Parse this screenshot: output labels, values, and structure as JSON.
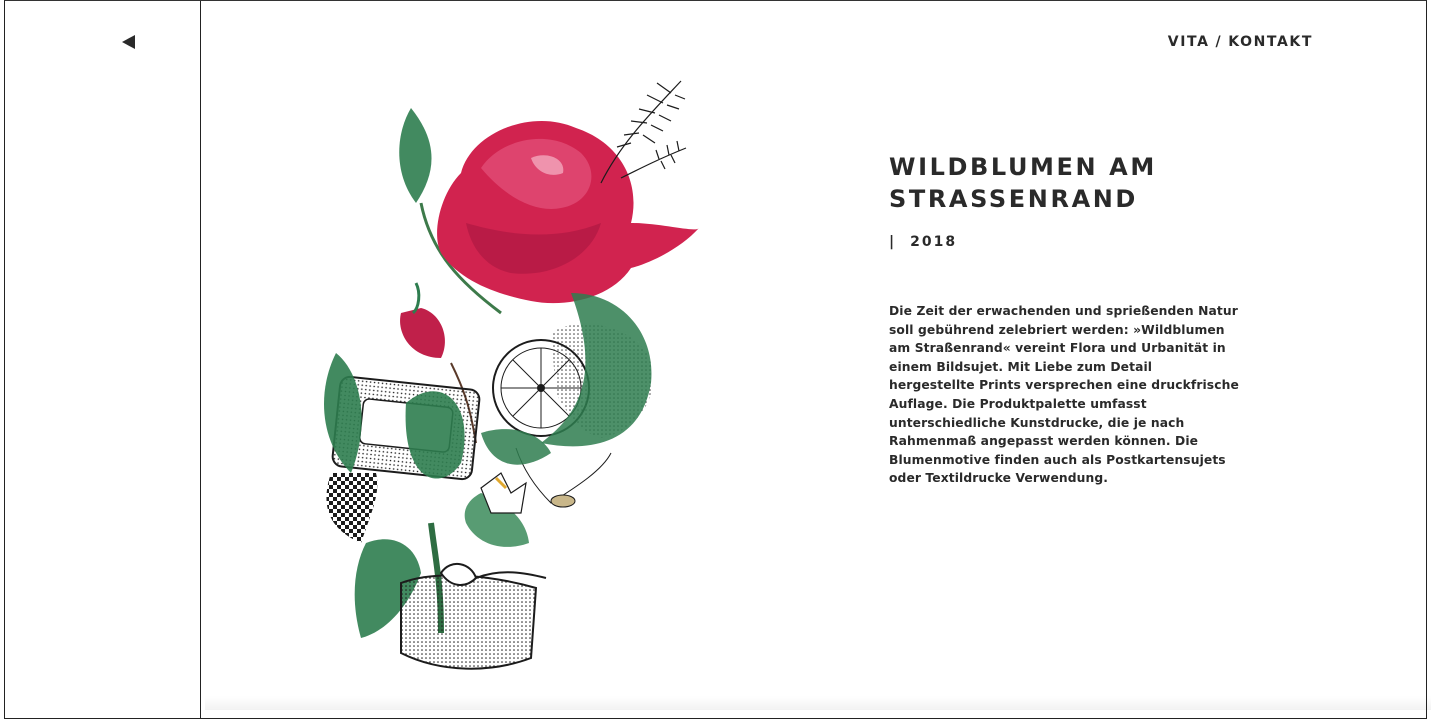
{
  "nav": {
    "back_icon": "back-arrow-icon",
    "vita_label": "VITA",
    "separator": "/",
    "kontakt_label": "KONTAKT"
  },
  "project": {
    "title": "WILDBLUMEN AM\nSTRASSENRAND",
    "year_marker": "|",
    "year": "2018",
    "description": "Die Zeit der erwachenden und sprießenden Natur soll gebührend zelebriert werden: »Wildblumen am Straßenrand« vereint Flora und Urbanität in einem Bildsujet. Mit Liebe zum Detail hergestellte Prints versprechen eine druckfrische Auflage. Die Produktpalette umfasst unterschiedliche Kunstdrucke, die je nach Rahmenmaß angepasst werden können. Die Blumenmotive finden auch als Postkartensujets oder Textildrucke Verwendung."
  },
  "colors": {
    "rose": "#d1234f",
    "leaf": "#2e7d4f",
    "ink": "#1c1c1c"
  }
}
